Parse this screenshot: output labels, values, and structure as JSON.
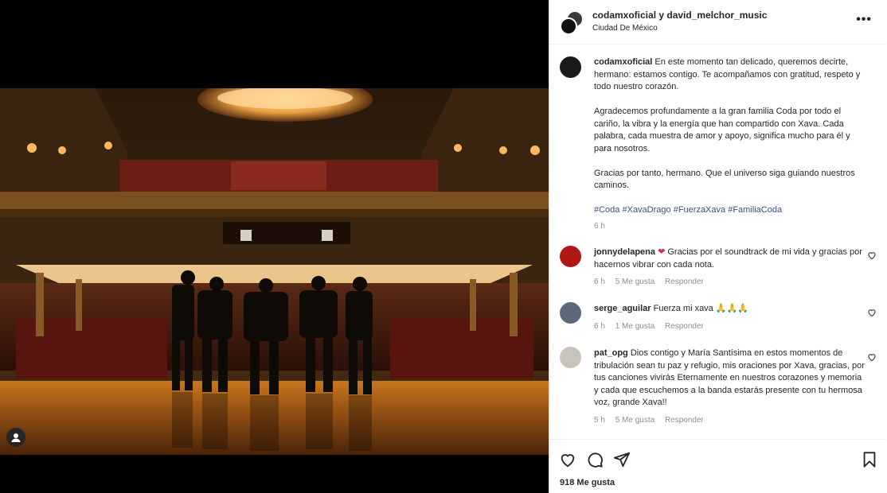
{
  "post": {
    "authors": "codamxoficial y david_melchor_music",
    "location": "Ciudad De México",
    "more_icon": "more-horizontal-icon",
    "likes": "918 Me gusta"
  },
  "caption": {
    "username": "codamxoficial",
    "paragraphs": [
      "En este momento tan delicado, queremos decirte, hermano: estamos contigo. Te acompañamos con gratitud, respeto y todo nuestro corazón.",
      "Agradecemos profundamente a la gran familia Coda por todo el cariño, la vibra y la energía que han compartido con Xava. Cada palabra, cada muestra de amor y apoyo, significa mucho para él y para nosotros.",
      "Gracias por tanto, hermano. Que el universo siga guiando nuestros caminos."
    ],
    "hashtags": [
      "#Coda",
      "#XavaDrago",
      "#FuerzaXava",
      "#FamiliaCoda"
    ],
    "time": "6 h"
  },
  "comments": [
    {
      "username": "jonnydelapena",
      "emoji": "❤",
      "text": "Gracias por el soundtrack de mi vida y gracias por hacernos vibrar con cada nota.",
      "time": "6 h",
      "likes": "5 Me gusta",
      "reply": "Responder",
      "avatar_color": "#b01818"
    },
    {
      "username": "serge_aguilar",
      "text": "Fuerza mi xava",
      "emoji": "🙏🙏🙏",
      "time": "6 h",
      "likes": "1 Me gusta",
      "reply": "Responder",
      "avatar_color": "#5a6a7a"
    },
    {
      "username": "pat_opg",
      "text": "Dios contigo y María Santísima en estos momentos de tribulación sean tu paz y refugio, mis oraciones por Xava, gracias, por tus canciones vivirás Eternamente en nuestros corazones y memoria y cada que escuchemos a la banda estarás presente con tu hermosa voz, grande Xava!!",
      "time": "5 h",
      "likes": "5 Me gusta",
      "reply": "Responder",
      "avatar_color": "#c8c4bc"
    }
  ],
  "icons": {
    "like": "heart-icon",
    "comment": "comment-icon",
    "share": "share-icon",
    "save": "bookmark-icon",
    "tag": "user-tag-icon"
  },
  "colors": {
    "hashtag": "#385185",
    "muted": "#8e8e8e",
    "stage_glow": "#d98a2b"
  }
}
